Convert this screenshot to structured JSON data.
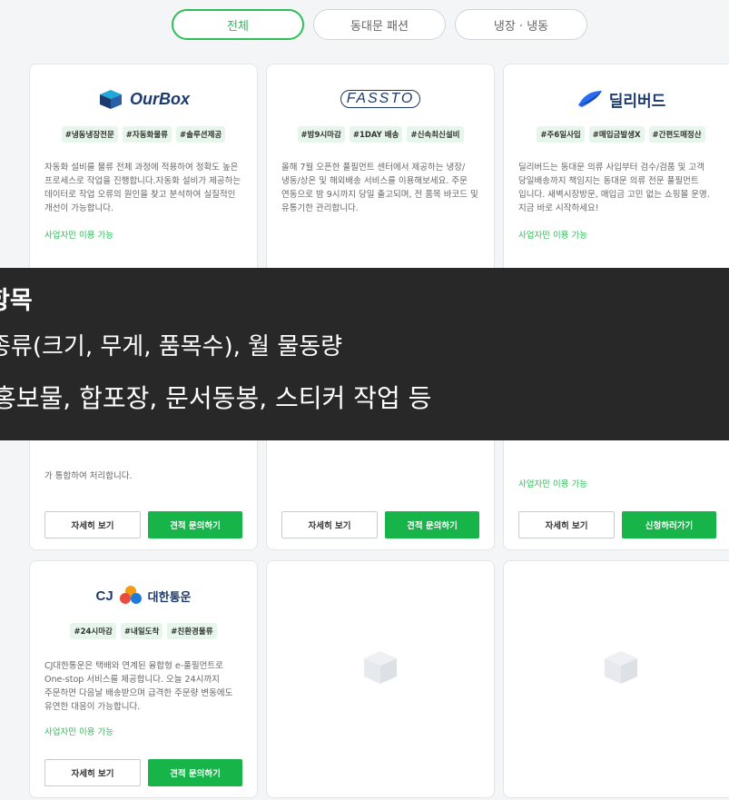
{
  "tabs": [
    {
      "label": "전체",
      "active": true
    },
    {
      "label": "동대문 패션",
      "active": false
    },
    {
      "label": "냉장 · 냉동",
      "active": false
    }
  ],
  "cards": [
    {
      "logo": "OurBox",
      "tags": [
        "#냉동냉장전문",
        "#자동화물류",
        "#솔루션제공"
      ],
      "desc": "자동화 설비를 물류 전체 과정에 적용하여 정확도 높은 프로세스로 작업을 진행합니다.자동화 설비가 제공하는 데이터로 작업 오류의 원인을 찾고 분석하여 실질적인 개선이 가능합니다.",
      "avail": "사업자만 이용 가능"
    },
    {
      "logo": "FASSTO",
      "tags": [
        "#밤9시마감",
        "#1DAY 배송",
        "#신속최신설비"
      ],
      "desc": "올해 7월 오픈한 풀필먼트 센터에서 제공하는 냉장/냉동/상온 및 해외배송 서비스를 이용해보세요. 주문 연동으로 밤 9시까지 당일 출고되며, 전 품목 바코드 및 유통기한 관리합니다.",
      "avail": ""
    },
    {
      "logo": "딜리버드",
      "tags": [
        "#주6일사입",
        "#매입금발생X",
        "#간편도매정산"
      ],
      "desc": "딜리버드는 동대문 의류 사입부터 검수/검품 및 고객 당일배송까지 책임지는 동대문 의류 전문 풀필먼트 입니다. 새벽시장방문, 매입금 고민 없는 쇼핑몰 운영. 지금 바로 시작하세요!",
      "avail": "사업자만 이용 가능"
    },
    {
      "desc_tail": "가 통합하여 처리합니다.",
      "detail": "자세히 보기",
      "inquiry": "견적 문의하기"
    },
    {
      "detail": "자세히 보기",
      "inquiry": "견적 문의하기"
    },
    {
      "avail": "사업자만 이용 가능",
      "detail": "자세히 보기",
      "apply": "신청하러가기"
    },
    {
      "logo": "대한통운",
      "logo_prefix": "CJ",
      "tags": [
        "#24시마감",
        "#내일도착",
        "#친환경물류"
      ],
      "desc": "CJ대한통운은 택배와 연계된 융합형 e-풀필먼트로 One-stop 서비스를 제공합니다. 오늘 24시까지 주문하면 다음날 배송받으며 급격한 주문량 변동에도 유연한 대응이 가능합니다.",
      "avail": "사업자만 이용 가능",
      "detail": "자세히 보기",
      "inquiry": "견적 문의하기"
    }
  ],
  "overlay": {
    "line1": "항목",
    "line2": "종류(크기, 무게, 품목수), 월 물동량",
    "line3": "홍보물, 합포장, 문서동봉, 스티커 작업 등"
  },
  "colors": {
    "accent": "#2ebd56",
    "button_green": "#17b44a",
    "tag_bg": "#e6f6ea"
  }
}
